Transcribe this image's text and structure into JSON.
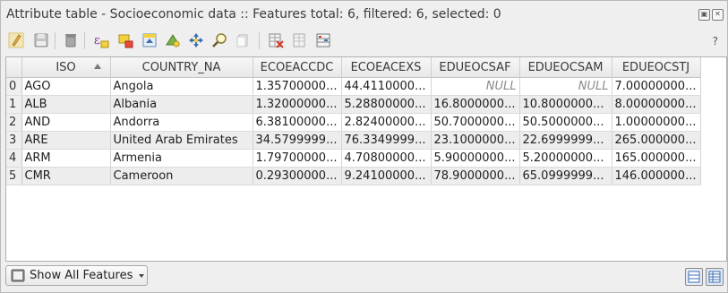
{
  "window": {
    "title": "Attribute table - Socioeconomic data :: Features total: 6, filtered: 6, selected: 0",
    "float_icon": "float-icon",
    "close_icon": "close-icon"
  },
  "toolbar": {
    "icons": [
      "toggle-editing-icon",
      "save-edits-icon",
      "delete-selected-icon",
      "select-by-expression-icon",
      "deselect-all-icon",
      "move-selection-to-top-icon",
      "invert-selection-icon",
      "pan-to-selected-icon",
      "zoom-to-selected-icon",
      "copy-rows-icon",
      "delete-field-icon",
      "new-field-icon",
      "open-field-calculator-icon"
    ],
    "help_label": "?"
  },
  "table": {
    "columns": [
      "ISO",
      "COUNTRY_NA",
      "ECOEACCDC",
      "ECOEACEXS",
      "EDUEOCSAF",
      "EDUEOCSAM",
      "EDUEOCSTJ"
    ],
    "sorted_column": "ISO",
    "rows": [
      {
        "index": "0",
        "cells": [
          "AGO",
          "Angola",
          "1.35700000...",
          "44.4110000...",
          "NULL",
          "NULL",
          "7.00000000..."
        ]
      },
      {
        "index": "1",
        "cells": [
          "ALB",
          "Albania",
          "1.32000000...",
          "5.28800000...",
          "16.8000000...",
          "10.8000000...",
          "8.00000000..."
        ]
      },
      {
        "index": "2",
        "cells": [
          "AND",
          "Andorra",
          "6.38100000...",
          "2.82400000...",
          "50.7000000...",
          "50.5000000...",
          "1.00000000..."
        ]
      },
      {
        "index": "3",
        "cells": [
          "ARE",
          "United Arab Emirates",
          "34.5799999...",
          "76.3349999...",
          "23.1000000...",
          "22.6999999...",
          "265.000000..."
        ]
      },
      {
        "index": "4",
        "cells": [
          "ARM",
          "Armenia",
          "1.79700000...",
          "4.70800000...",
          "5.90000000...",
          "5.20000000...",
          "165.000000..."
        ]
      },
      {
        "index": "5",
        "cells": [
          "CMR",
          "Cameroon",
          "0.29300000...",
          "9.24100000...",
          "78.9000000...",
          "65.0999999...",
          "146.000000..."
        ]
      }
    ]
  },
  "footer": {
    "filter_label": "Show All Features",
    "filter_icon": "filter-icon",
    "view_icons": [
      "table-view-icon",
      "form-view-icon"
    ]
  }
}
